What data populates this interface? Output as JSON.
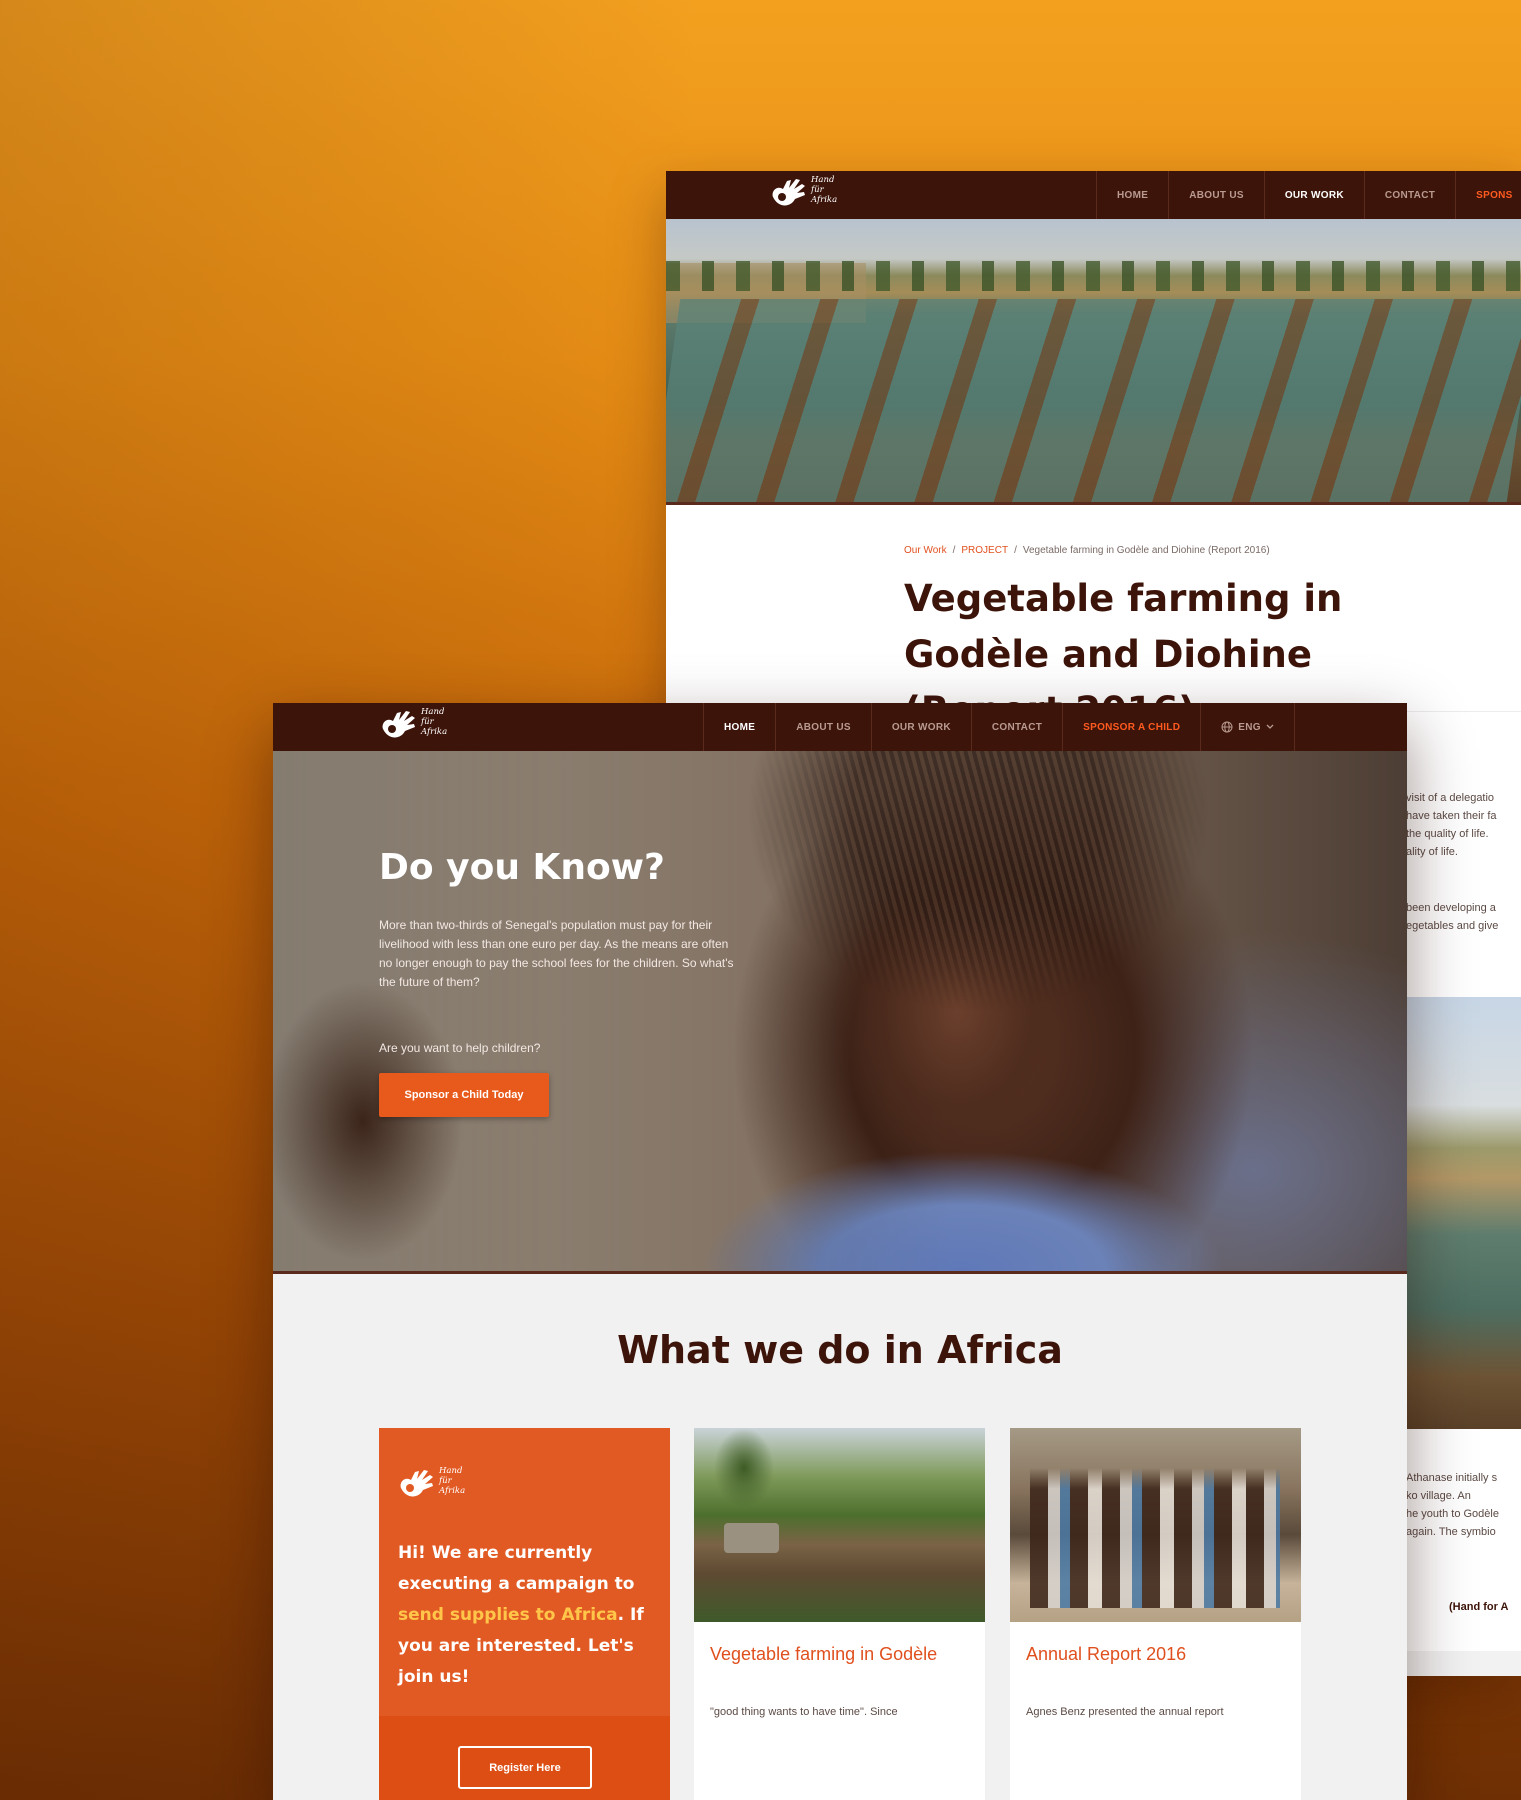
{
  "back_window": {
    "logo_text": [
      "Hand",
      "für",
      "Afrika"
    ],
    "nav": {
      "items": [
        "HOME",
        "ABOUT US",
        "OUR WORK",
        "CONTACT",
        "SPONS"
      ],
      "active": "OUR WORK"
    },
    "breadcrumb": {
      "link1": "Our Work",
      "sep1": "/",
      "link2": "PROJECT",
      "sep2": "/",
      "current": "Vegetable farming in Godèle and Diohine (Report 2016)"
    },
    "title": "Vegetable farming in Godèle and Diohine (Report 2016)",
    "text_lines_top": [
      "visit of a delegatio",
      "have taken their fa",
      "the quality of life.",
      "ality of life."
    ],
    "text_lines_mid": [
      "been developing a",
      "egetables and give"
    ],
    "text_lines_bottom": [
      "Athanase initially s",
      "ko village. An",
      "he youth to Godèle",
      "again. The symbio"
    ],
    "signature": "(Hand for A"
  },
  "front_window": {
    "logo_text": [
      "Hand",
      "für",
      "Afrika"
    ],
    "nav": {
      "home": "HOME",
      "about": "ABOUT US",
      "work": "OUR WORK",
      "contact": "CONTACT",
      "sponsor": "SPONSOR A CHILD",
      "language": "ENG",
      "active": "HOME"
    },
    "hero": {
      "title": "Do you Know?",
      "body": "More than two-thirds of Senegal's population must pay for their livelihood with less than one euro per day. As the means are often no longer enough to pay the school fees for the children. So what's the future of them?",
      "question": "Are you want to help children?",
      "cta": "Sponsor a Child Today"
    },
    "section_title": "What we do in Africa",
    "promo_card": {
      "text_before": "Hi! We are currently executing a campaign to ",
      "highlight": "send supplies to Africa",
      "text_after": ". If you are interested. Let's join us!",
      "button": "Register Here"
    },
    "cards": [
      {
        "title": "Vegetable farming in Godèle",
        "excerpt": "\"good thing wants to have time\". Since"
      },
      {
        "title": "Annual Report 2016",
        "excerpt": "Agnes Benz presented the annual report"
      }
    ]
  },
  "colors": {
    "nav_bg": "#3d140a",
    "accent": "#e85a1c",
    "title_brown": "#3d140a",
    "highlight": "#ffc64a"
  }
}
